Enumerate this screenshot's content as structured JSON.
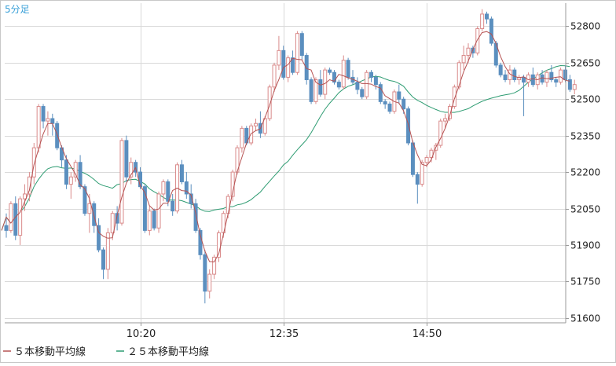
{
  "chart_data": {
    "type": "candlestick",
    "timeframe": "5分足",
    "y_ticks": [
      51600,
      51750,
      51900,
      52050,
      52200,
      52350,
      52500,
      52650,
      52800
    ],
    "ylim": [
      51580,
      52895
    ],
    "x_ticks": [
      {
        "label": "10:20",
        "index": 29
      },
      {
        "label": "12:35",
        "index": 60
      },
      {
        "label": "14:50",
        "index": 91
      }
    ],
    "colors": {
      "up": "#d98a8a",
      "down": "#5b8fbf",
      "ma5": "#b65252",
      "ma25": "#2e9c72",
      "grid": "#d9d9d9",
      "tick_text": "#222222"
    },
    "legend": [
      {
        "label": "５本移動平均線",
        "color": "#b65252"
      },
      {
        "label": "２５本移動平均線",
        "color": "#2e9c72"
      }
    ],
    "candles": [
      [
        51980,
        52030,
        51930,
        51960
      ],
      [
        51960,
        52080,
        51950,
        52070
      ],
      [
        52070,
        52100,
        51920,
        51940
      ],
      [
        51940,
        52100,
        51900,
        52090
      ],
      [
        52090,
        52150,
        52040,
        52110
      ],
      [
        52110,
        52200,
        52080,
        52180
      ],
      [
        52180,
        52320,
        52150,
        52300
      ],
      [
        52300,
        52480,
        52280,
        52470
      ],
      [
        52470,
        52480,
        52380,
        52410
      ],
      [
        52410,
        52450,
        52350,
        52420
      ],
      [
        52420,
        52440,
        52350,
        52400
      ],
      [
        52400,
        52410,
        52290,
        52300
      ],
      [
        52300,
        52310,
        52220,
        52250
      ],
      [
        52250,
        52270,
        52130,
        52150
      ],
      [
        52150,
        52200,
        52090,
        52180
      ],
      [
        52180,
        52250,
        52160,
        52240
      ],
      [
        52240,
        52270,
        52130,
        52140
      ],
      [
        52140,
        52150,
        52020,
        52030
      ],
      [
        52030,
        52110,
        51950,
        52070
      ],
      [
        52070,
        52080,
        51950,
        51980
      ],
      [
        51980,
        52010,
        51870,
        51880
      ],
      [
        51880,
        51890,
        51760,
        51800
      ],
      [
        51800,
        51970,
        51760,
        51950
      ],
      [
        51950,
        52040,
        51920,
        52030
      ],
      [
        52030,
        52060,
        51960,
        51990
      ],
      [
        51990,
        52340,
        51980,
        52330
      ],
      [
        52330,
        52350,
        52160,
        52180
      ],
      [
        52180,
        52260,
        52150,
        52240
      ],
      [
        52240,
        52250,
        52180,
        52200
      ],
      [
        52200,
        52220,
        52130,
        52140
      ],
      [
        52140,
        52150,
        51950,
        51960
      ],
      [
        51960,
        52060,
        51940,
        52040
      ],
      [
        52040,
        52050,
        51960,
        51970
      ],
      [
        51970,
        52120,
        51950,
        52110
      ],
      [
        52110,
        52170,
        52080,
        52160
      ],
      [
        52160,
        52170,
        52060,
        52080
      ],
      [
        52080,
        52110,
        52020,
        52040
      ],
      [
        52040,
        52240,
        52030,
        52230
      ],
      [
        52230,
        52250,
        52150,
        52160
      ],
      [
        52160,
        52200,
        52090,
        52110
      ],
      [
        52110,
        52150,
        52050,
        52070
      ],
      [
        52070,
        52090,
        51950,
        51960
      ],
      [
        51960,
        51970,
        51840,
        51860
      ],
      [
        51860,
        51880,
        51660,
        51710
      ],
      [
        51710,
        51800,
        51680,
        51780
      ],
      [
        51780,
        51860,
        51760,
        51850
      ],
      [
        51850,
        51960,
        51830,
        51950
      ],
      [
        51950,
        52040,
        51930,
        52030
      ],
      [
        52030,
        52110,
        52010,
        52100
      ],
      [
        52100,
        52210,
        52080,
        52200
      ],
      [
        52200,
        52310,
        52190,
        52300
      ],
      [
        52300,
        52390,
        52280,
        52380
      ],
      [
        52380,
        52390,
        52310,
        52320
      ],
      [
        52320,
        52400,
        52310,
        52390
      ],
      [
        52390,
        52420,
        52370,
        52400
      ],
      [
        52400,
        52450,
        52340,
        52360
      ],
      [
        52360,
        52430,
        52350,
        52420
      ],
      [
        52420,
        52560,
        52410,
        52550
      ],
      [
        52550,
        52650,
        52530,
        52640
      ],
      [
        52640,
        52760,
        52620,
        52700
      ],
      [
        52700,
        52720,
        52580,
        52590
      ],
      [
        52590,
        52680,
        52570,
        52670
      ],
      [
        52670,
        52700,
        52600,
        52610
      ],
      [
        52610,
        52780,
        52600,
        52770
      ],
      [
        52770,
        52780,
        52660,
        52680
      ],
      [
        52680,
        52690,
        52560,
        52580
      ],
      [
        52580,
        52590,
        52480,
        52490
      ],
      [
        52490,
        52590,
        52480,
        52580
      ],
      [
        52580,
        52620,
        52510,
        52520
      ],
      [
        52520,
        52630,
        52500,
        52620
      ],
      [
        52620,
        52630,
        52600,
        52610
      ],
      [
        52610,
        52620,
        52560,
        52570
      ],
      [
        52570,
        52580,
        52540,
        52550
      ],
      [
        52550,
        52680,
        52540,
        52660
      ],
      [
        52660,
        52670,
        52580,
        52590
      ],
      [
        52590,
        52620,
        52560,
        52570
      ],
      [
        52570,
        52590,
        52520,
        52540
      ],
      [
        52540,
        52550,
        52500,
        52510
      ],
      [
        52510,
        52620,
        52500,
        52610
      ],
      [
        52610,
        52620,
        52570,
        52590
      ],
      [
        52590,
        52600,
        52540,
        52560
      ],
      [
        52560,
        52570,
        52480,
        52490
      ],
      [
        52490,
        52500,
        52460,
        52480
      ],
      [
        52480,
        52490,
        52440,
        52450
      ],
      [
        52450,
        52540,
        52440,
        52530
      ],
      [
        52530,
        52560,
        52480,
        52500
      ],
      [
        52500,
        52510,
        52440,
        52460
      ],
      [
        52460,
        52470,
        52310,
        52320
      ],
      [
        52320,
        52330,
        52180,
        52190
      ],
      [
        52190,
        52200,
        52070,
        52150
      ],
      [
        52150,
        52250,
        52140,
        52240
      ],
      [
        52240,
        52270,
        52220,
        52260
      ],
      [
        52260,
        52300,
        52240,
        52290
      ],
      [
        52290,
        52320,
        52250,
        52310
      ],
      [
        52310,
        52420,
        52300,
        52410
      ],
      [
        52410,
        52440,
        52380,
        52420
      ],
      [
        52420,
        52480,
        52410,
        52470
      ],
      [
        52470,
        52560,
        52460,
        52550
      ],
      [
        52550,
        52660,
        52540,
        52650
      ],
      [
        52650,
        52720,
        52620,
        52680
      ],
      [
        52680,
        52730,
        52650,
        52710
      ],
      [
        52710,
        52720,
        52670,
        52690
      ],
      [
        52690,
        52800,
        52680,
        52790
      ],
      [
        52790,
        52870,
        52780,
        52850
      ],
      [
        52850,
        52860,
        52810,
        52830
      ],
      [
        52830,
        52840,
        52720,
        52730
      ],
      [
        52730,
        52740,
        52630,
        52640
      ],
      [
        52640,
        52650,
        52590,
        52600
      ],
      [
        52600,
        52620,
        52570,
        52580
      ],
      [
        52580,
        52640,
        52560,
        52620
      ],
      [
        52620,
        52630,
        52570,
        52580
      ],
      [
        52580,
        52600,
        52560,
        52590
      ],
      [
        52590,
        52600,
        52430,
        52570
      ],
      [
        52570,
        52610,
        52550,
        52600
      ],
      [
        52600,
        52630,
        52550,
        52560
      ],
      [
        52560,
        52610,
        52540,
        52600
      ],
      [
        52600,
        52620,
        52560,
        52570
      ],
      [
        52570,
        52620,
        52550,
        52610
      ],
      [
        52610,
        52640,
        52570,
        52580
      ],
      [
        52580,
        52590,
        52550,
        52570
      ],
      [
        52570,
        52630,
        52560,
        52620
      ],
      [
        52620,
        52640,
        52570,
        52580
      ],
      [
        52580,
        52600,
        52530,
        52540
      ],
      [
        52540,
        52580,
        52520,
        52560
      ]
    ]
  }
}
